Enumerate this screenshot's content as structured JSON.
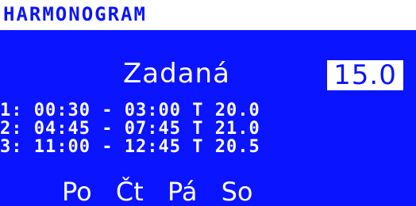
{
  "header": {
    "title": "HARMONOGRAM"
  },
  "setpoint": {
    "label": "Zadaná",
    "value": "15.0"
  },
  "schedule": [
    {
      "index": "1:",
      "start": "00:30",
      "sep": "-",
      "end": "03:00",
      "t_label": "T",
      "temp": "20.0"
    },
    {
      "index": "2:",
      "start": "04:45",
      "sep": "-",
      "end": "07:45",
      "t_label": "T",
      "temp": "21.0"
    },
    {
      "index": "3:",
      "start": "11:00",
      "sep": "-",
      "end": "12:45",
      "t_label": "T",
      "temp": "20.5"
    }
  ],
  "days": [
    "Po",
    "Čt",
    "Pá",
    "So"
  ],
  "colors": {
    "background": "#0a14ff",
    "text": "#ffffff",
    "title": "#0a14ff"
  }
}
